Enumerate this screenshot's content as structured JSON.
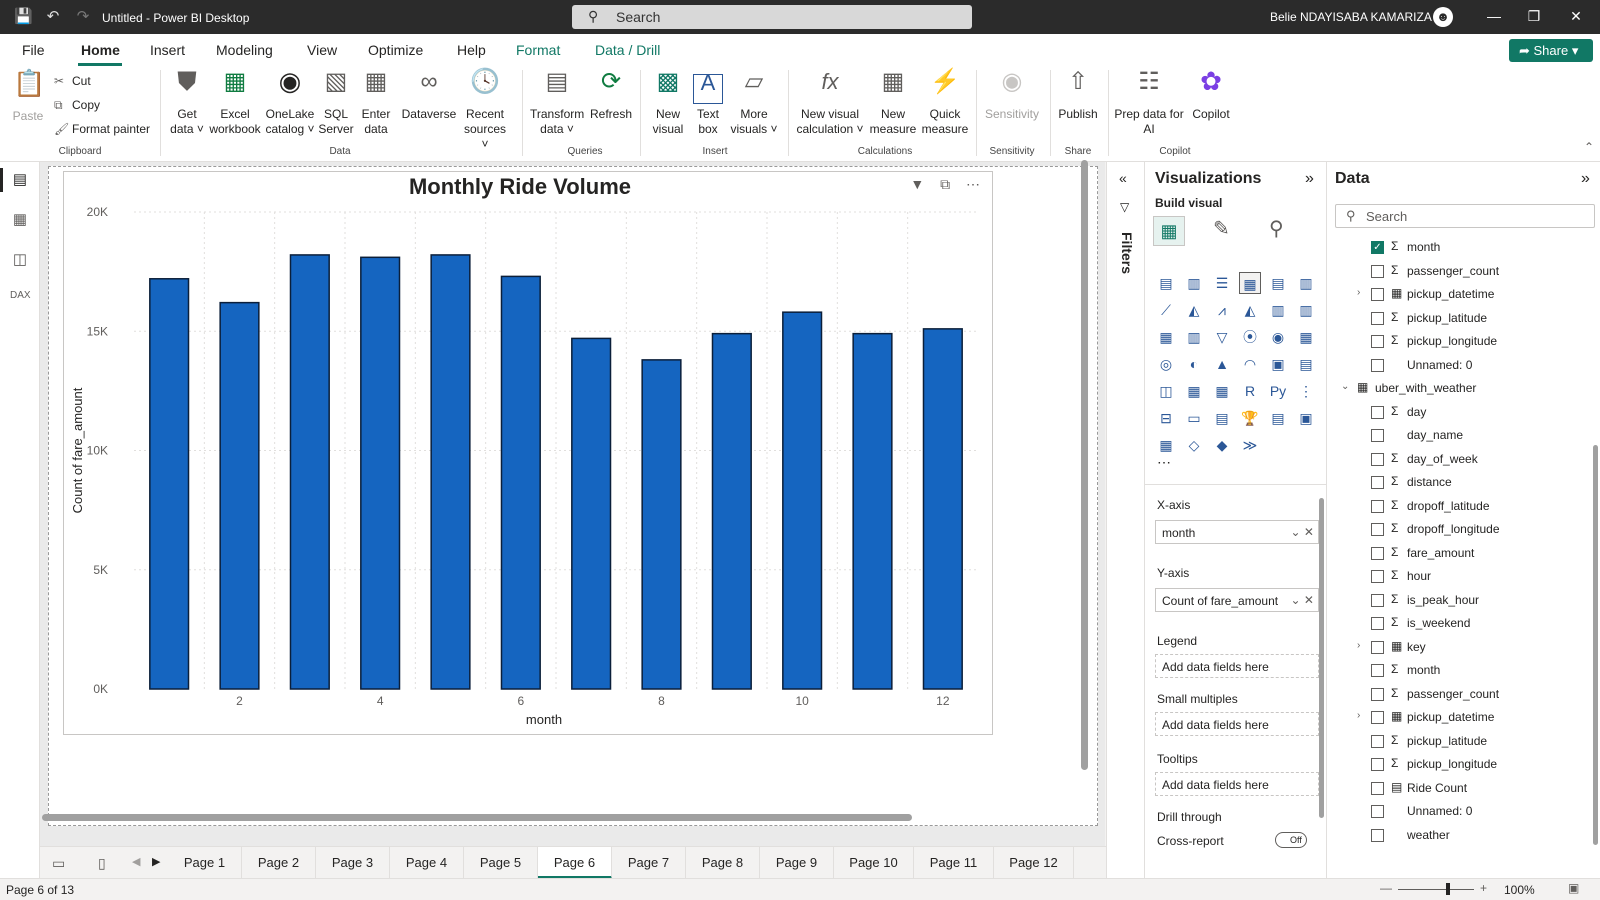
{
  "titlebar": {
    "title": "Untitled - Power BI Desktop",
    "search_placeholder": "Search",
    "user": "Belie NDAYISABA KAMARIZA"
  },
  "menu": {
    "tabs": [
      "File",
      "Home",
      "Insert",
      "Modeling",
      "View",
      "Optimize",
      "Help",
      "Format",
      "Data / Drill"
    ],
    "share": "Share"
  },
  "ribbon": {
    "clipboard": {
      "paste": "Paste",
      "cut": "Cut",
      "copy": "Copy",
      "format_painter": "Format painter",
      "label": "Clipboard"
    },
    "data": {
      "get_data": "Get data",
      "excel": "Excel workbook",
      "onelake": "OneLake catalog",
      "sql": "SQL Server",
      "enter": "Enter data",
      "dataverse": "Dataverse",
      "recent": "Recent sources",
      "label": "Data"
    },
    "queries": {
      "transform": "Transform data",
      "refresh": "Refresh",
      "label": "Queries"
    },
    "insert": {
      "new_visual": "New visual",
      "text_box": "Text box",
      "more_visuals": "More visuals",
      "label": "Insert"
    },
    "calculations": {
      "new_visual_calc": "New visual calculation",
      "new_measure": "New measure",
      "quick_measure": "Quick measure",
      "label": "Calculations"
    },
    "sensitivity": {
      "sensitivity": "Sensitivity",
      "label": "Sensitivity"
    },
    "share": {
      "publish": "Publish",
      "label": "Share"
    },
    "copilot": {
      "prep": "Prep data for AI",
      "copilot": "Copilot",
      "label": "Copilot"
    }
  },
  "chart_data": {
    "type": "bar",
    "title": "Monthly Ride Volume",
    "xlabel": "month",
    "ylabel": "Count of fare_amount",
    "categories": [
      1,
      2,
      3,
      4,
      5,
      6,
      7,
      8,
      9,
      10,
      11,
      12
    ],
    "x_tick_labels": [
      "2",
      "4",
      "6",
      "8",
      "10",
      "12"
    ],
    "values": [
      17200,
      16200,
      18200,
      18100,
      18200,
      17300,
      14700,
      13800,
      14900,
      15800,
      14900,
      15100
    ],
    "y_ticks": [
      "0K",
      "5K",
      "10K",
      "15K",
      "20K"
    ],
    "ylim": [
      0,
      20000
    ],
    "bar_color": "#1565c0",
    "grid": true
  },
  "pages": {
    "tabs": [
      "Page 1",
      "Page 2",
      "Page 3",
      "Page 4",
      "Page 5",
      "Page 6",
      "Page 7",
      "Page 8",
      "Page 9",
      "Page 10",
      "Page 11",
      "Page 12"
    ],
    "active": "Page 6"
  },
  "status": {
    "page_info": "Page 6 of 13",
    "zoom": "100%"
  },
  "filters": {
    "label": "Filters"
  },
  "visualizations": {
    "title": "Visualizations",
    "build_visual": "Build visual",
    "xaxis_label": "X-axis",
    "xaxis_value": "month",
    "yaxis_label": "Y-axis",
    "yaxis_value": "Count of fare_amount",
    "legend_label": "Legend",
    "legend_placeholder": "Add data fields here",
    "small_multiples_label": "Small multiples",
    "small_multiples_placeholder": "Add data fields here",
    "tooltips_label": "Tooltips",
    "tooltips_placeholder": "Add data fields here",
    "drill_label": "Drill through",
    "cross_report": "Cross-report",
    "toggle": "Off"
  },
  "data_pane": {
    "title": "Data",
    "search_placeholder": "Search",
    "fields": [
      {
        "name": "month",
        "type": "sigma",
        "checked": true,
        "level": 1
      },
      {
        "name": "passenger_count",
        "type": "sigma",
        "checked": false,
        "level": 1
      },
      {
        "name": "pickup_datetime",
        "type": "calendar",
        "checked": false,
        "level": 1,
        "expand": true
      },
      {
        "name": "pickup_latitude",
        "type": "sigma",
        "checked": false,
        "level": 1
      },
      {
        "name": "pickup_longitude",
        "type": "sigma",
        "checked": false,
        "level": 1
      },
      {
        "name": "Unnamed: 0",
        "type": "",
        "checked": false,
        "level": 1
      },
      {
        "name": "uber_with_weather",
        "type": "table",
        "checked": false,
        "level": 0
      },
      {
        "name": "day",
        "type": "sigma",
        "checked": false,
        "level": 1
      },
      {
        "name": "day_name",
        "type": "",
        "checked": false,
        "level": 1
      },
      {
        "name": "day_of_week",
        "type": "sigma",
        "checked": false,
        "level": 1
      },
      {
        "name": "distance",
        "type": "sigma",
        "checked": false,
        "level": 1
      },
      {
        "name": "dropoff_latitude",
        "type": "sigma",
        "checked": false,
        "level": 1
      },
      {
        "name": "dropoff_longitude",
        "type": "sigma",
        "checked": false,
        "level": 1
      },
      {
        "name": "fare_amount",
        "type": "sigma",
        "checked": false,
        "level": 1
      },
      {
        "name": "hour",
        "type": "sigma",
        "checked": false,
        "level": 1
      },
      {
        "name": "is_peak_hour",
        "type": "sigma",
        "checked": false,
        "level": 1
      },
      {
        "name": "is_weekend",
        "type": "sigma",
        "checked": false,
        "level": 1
      },
      {
        "name": "key",
        "type": "calendar",
        "checked": false,
        "level": 1,
        "expand": true
      },
      {
        "name": "month",
        "type": "sigma",
        "checked": false,
        "level": 1
      },
      {
        "name": "passenger_count",
        "type": "sigma",
        "checked": false,
        "level": 1
      },
      {
        "name": "pickup_datetime",
        "type": "calendar",
        "checked": false,
        "level": 1,
        "expand": true
      },
      {
        "name": "pickup_latitude",
        "type": "sigma",
        "checked": false,
        "level": 1
      },
      {
        "name": "pickup_longitude",
        "type": "sigma",
        "checked": false,
        "level": 1
      },
      {
        "name": "Ride Count",
        "type": "calc",
        "checked": false,
        "level": 1
      },
      {
        "name": "Unnamed: 0",
        "type": "",
        "checked": false,
        "level": 1
      },
      {
        "name": "weather",
        "type": "",
        "checked": false,
        "level": 1
      }
    ]
  }
}
